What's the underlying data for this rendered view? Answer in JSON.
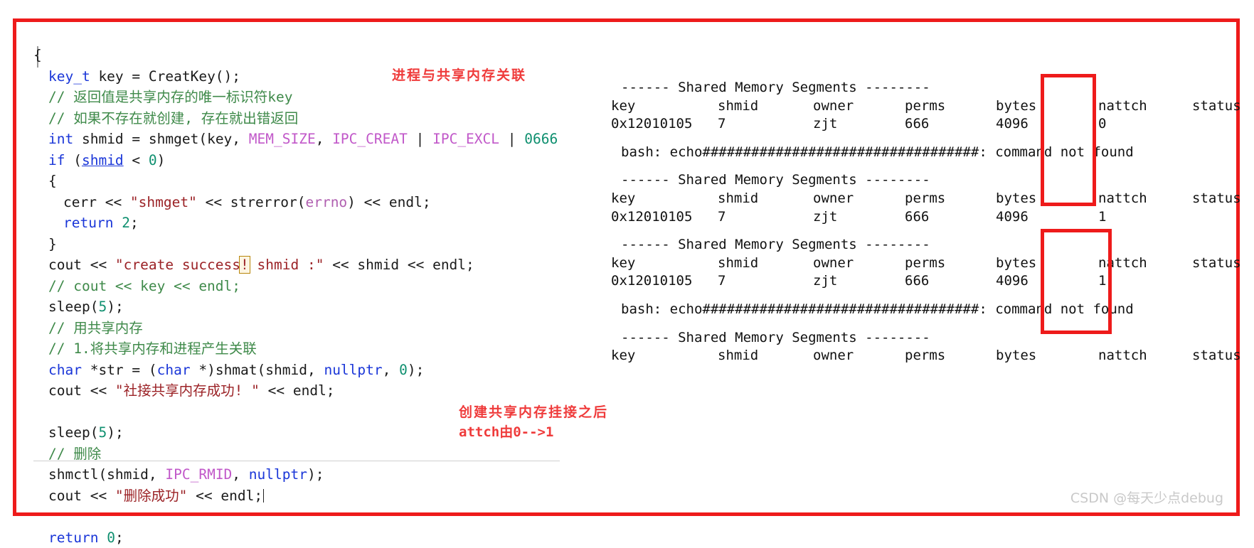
{
  "editor": {
    "name": "cpp-source-editor",
    "lines": [
      {
        "id": "l1",
        "indent": 0,
        "tokens": [
          {
            "t": "plain",
            "v": "{"
          }
        ]
      },
      {
        "id": "l2",
        "indent": 1,
        "tokens": [
          {
            "t": "type",
            "v": "key_t"
          },
          {
            "t": "plain",
            "v": " key = CreatKey();"
          }
        ]
      },
      {
        "id": "l3",
        "indent": 1,
        "tokens": [
          {
            "t": "cmt",
            "v": "// 返回值是共享内存的唯一标识符key"
          }
        ]
      },
      {
        "id": "l4",
        "indent": 1,
        "tokens": [
          {
            "t": "cmt",
            "v": "// 如果不存在就创建, 存在就出错返回"
          }
        ]
      },
      {
        "id": "l5",
        "indent": 1,
        "tokens": [
          {
            "t": "kw",
            "v": "int"
          },
          {
            "t": "plain",
            "v": " shmid = shmget(key, "
          },
          {
            "t": "macro",
            "v": "MEM_SIZE"
          },
          {
            "t": "plain",
            "v": ", "
          },
          {
            "t": "macro",
            "v": "IPC_CREAT"
          },
          {
            "t": "plain",
            "v": " | "
          },
          {
            "t": "macro",
            "v": "IPC_EXCL"
          },
          {
            "t": "plain",
            "v": " | "
          },
          {
            "t": "num",
            "v": "0666"
          }
        ]
      },
      {
        "id": "l6",
        "indent": 1,
        "tokens": [
          {
            "t": "kw",
            "v": "if"
          },
          {
            "t": "plain",
            "v": " ("
          },
          {
            "t": "ul",
            "v": "shmid"
          },
          {
            "t": "plain",
            "v": " < "
          },
          {
            "t": "num",
            "v": "0"
          },
          {
            "t": "plain",
            "v": ")"
          }
        ]
      },
      {
        "id": "l7",
        "indent": 1,
        "tokens": [
          {
            "t": "plain",
            "v": "{"
          }
        ]
      },
      {
        "id": "l8",
        "indent": 2,
        "tokens": [
          {
            "t": "plain",
            "v": "cerr << "
          },
          {
            "t": "str",
            "v": "\"shmget\""
          },
          {
            "t": "plain",
            "v": " << strerror("
          },
          {
            "t": "param",
            "v": "errno"
          },
          {
            "t": "plain",
            "v": ") << endl;"
          }
        ]
      },
      {
        "id": "l9",
        "indent": 2,
        "tokens": [
          {
            "t": "kw",
            "v": "return"
          },
          {
            "t": "plain",
            "v": " "
          },
          {
            "t": "num",
            "v": "2"
          },
          {
            "t": "plain",
            "v": ";"
          }
        ]
      },
      {
        "id": "l10",
        "indent": 1,
        "tokens": [
          {
            "t": "plain",
            "v": "}"
          }
        ]
      },
      {
        "id": "l11",
        "indent": 1,
        "tokens": [
          {
            "t": "plain",
            "v": "cout << "
          },
          {
            "t": "str",
            "v": "\"create success"
          },
          {
            "t": "cursor",
            "v": "!"
          },
          {
            "t": "str",
            "v": " shmid :\""
          },
          {
            "t": "plain",
            "v": " << shmid << endl;"
          }
        ]
      },
      {
        "id": "l12",
        "indent": 1,
        "tokens": [
          {
            "t": "cmt",
            "v": "// cout << key << endl;"
          }
        ]
      },
      {
        "id": "l13",
        "indent": 1,
        "tokens": [
          {
            "t": "plain",
            "v": "sleep("
          },
          {
            "t": "num",
            "v": "5"
          },
          {
            "t": "plain",
            "v": ");"
          }
        ]
      },
      {
        "id": "l14",
        "indent": 1,
        "tokens": [
          {
            "t": "cmt",
            "v": "// 用共享内存"
          }
        ]
      },
      {
        "id": "l15",
        "indent": 1,
        "tokens": [
          {
            "t": "cmt",
            "v": "// 1.将共享内存和进程产生关联"
          }
        ]
      },
      {
        "id": "l16",
        "indent": 1,
        "tokens": [
          {
            "t": "kw",
            "v": "char"
          },
          {
            "t": "plain",
            "v": " *str = ("
          },
          {
            "t": "kw",
            "v": "char"
          },
          {
            "t": "plain",
            "v": " *)shmat(shmid, "
          },
          {
            "t": "kw",
            "v": "nullptr"
          },
          {
            "t": "plain",
            "v": ", "
          },
          {
            "t": "num",
            "v": "0"
          },
          {
            "t": "plain",
            "v": ");"
          }
        ]
      },
      {
        "id": "l17",
        "indent": 1,
        "tokens": [
          {
            "t": "plain",
            "v": "cout << "
          },
          {
            "t": "str",
            "v": "\"社接共享内存成功! \""
          },
          {
            "t": "plain",
            "v": " << endl;"
          }
        ]
      },
      {
        "id": "l18",
        "indent": 1,
        "tokens": [
          {
            "t": "plain",
            "v": ""
          }
        ]
      },
      {
        "id": "l19",
        "indent": 1,
        "tokens": [
          {
            "t": "plain",
            "v": "sleep("
          },
          {
            "t": "num",
            "v": "5"
          },
          {
            "t": "plain",
            "v": ");"
          }
        ]
      },
      {
        "id": "l20",
        "indent": 1,
        "tokens": [
          {
            "t": "cmt",
            "v": "// 删除"
          }
        ]
      },
      {
        "id": "l21",
        "indent": 1,
        "tokens": [
          {
            "t": "plain",
            "v": "shmctl(shmid, "
          },
          {
            "t": "macro",
            "v": "IPC_RMID"
          },
          {
            "t": "plain",
            "v": ", "
          },
          {
            "t": "kw",
            "v": "nullptr"
          },
          {
            "t": "plain",
            "v": ");"
          }
        ]
      },
      {
        "id": "l22",
        "indent": 1,
        "tokens": [
          {
            "t": "plain",
            "v": "cout << "
          },
          {
            "t": "str",
            "v": "\"删除成功\""
          },
          {
            "t": "plain",
            "v": " << endl;"
          },
          {
            "t": "caret",
            "v": ""
          }
        ]
      },
      {
        "id": "l23",
        "indent": 1,
        "tokens": [
          {
            "t": "plain",
            "v": ""
          }
        ]
      },
      {
        "id": "l24",
        "indent": 1,
        "tokens": [
          {
            "t": "kw",
            "v": "return"
          },
          {
            "t": "plain",
            "v": " "
          },
          {
            "t": "num",
            "v": "0"
          },
          {
            "t": "plain",
            "v": ";"
          }
        ]
      }
    ]
  },
  "annotations": {
    "top": "进程与共享内存关联",
    "bottom_line1": "创建共享内存挂接之后",
    "bottom_line2": "attch由0-->1"
  },
  "terminal": {
    "header_rule": "------ Shared Memory Segments --------",
    "columns": [
      "key",
      "shmid",
      "owner",
      "perms",
      "bytes",
      "nattch",
      "status"
    ],
    "error_line": "bash: echo##################################: command not found",
    "blocks": [
      {
        "id": "block-1",
        "header": "------ Shared Memory Segments --------",
        "columns": [
          "key",
          "shmid",
          "owner",
          "perms",
          "bytes",
          "nattch",
          "status"
        ],
        "row": {
          "key": "0x12010105",
          "shmid": "7",
          "owner": "zjt",
          "perms": "666",
          "bytes": "4096",
          "nattch": "0",
          "status": ""
        },
        "after_error": true
      },
      {
        "id": "block-2",
        "header": "------ Shared Memory Segments --------",
        "columns": [
          "key",
          "shmid",
          "owner",
          "perms",
          "bytes",
          "nattch",
          "status"
        ],
        "row": {
          "key": "0x12010105",
          "shmid": "7",
          "owner": "zjt",
          "perms": "666",
          "bytes": "4096",
          "nattch": "1",
          "status": ""
        },
        "after_error": false
      },
      {
        "id": "block-3",
        "header": "------ Shared Memory Segments --------",
        "columns": [
          "key",
          "shmid",
          "owner",
          "perms",
          "bytes",
          "nattch",
          "status"
        ],
        "row": {
          "key": "0x12010105",
          "shmid": "7",
          "owner": "zjt",
          "perms": "666",
          "bytes": "4096",
          "nattch": "1",
          "status": ""
        },
        "after_error": true
      },
      {
        "id": "block-4",
        "header": "------ Shared Memory Segments --------",
        "columns": [
          "key",
          "shmid",
          "owner",
          "perms",
          "bytes",
          "nattch",
          "status"
        ],
        "row": null,
        "after_error": false
      }
    ]
  },
  "watermark": "CSDN @每天少点debug",
  "colors": {
    "frame_red": "#ee1b1b",
    "annotation_red": "#ef3b3b",
    "keyword_blue": "#1a36d8",
    "comment_green": "#3f8a4a",
    "macro_purple": "#c158c9",
    "string_red": "#9b2226",
    "number_teal": "#0e8f6f",
    "watermark_gray": "#c9c9c9"
  }
}
